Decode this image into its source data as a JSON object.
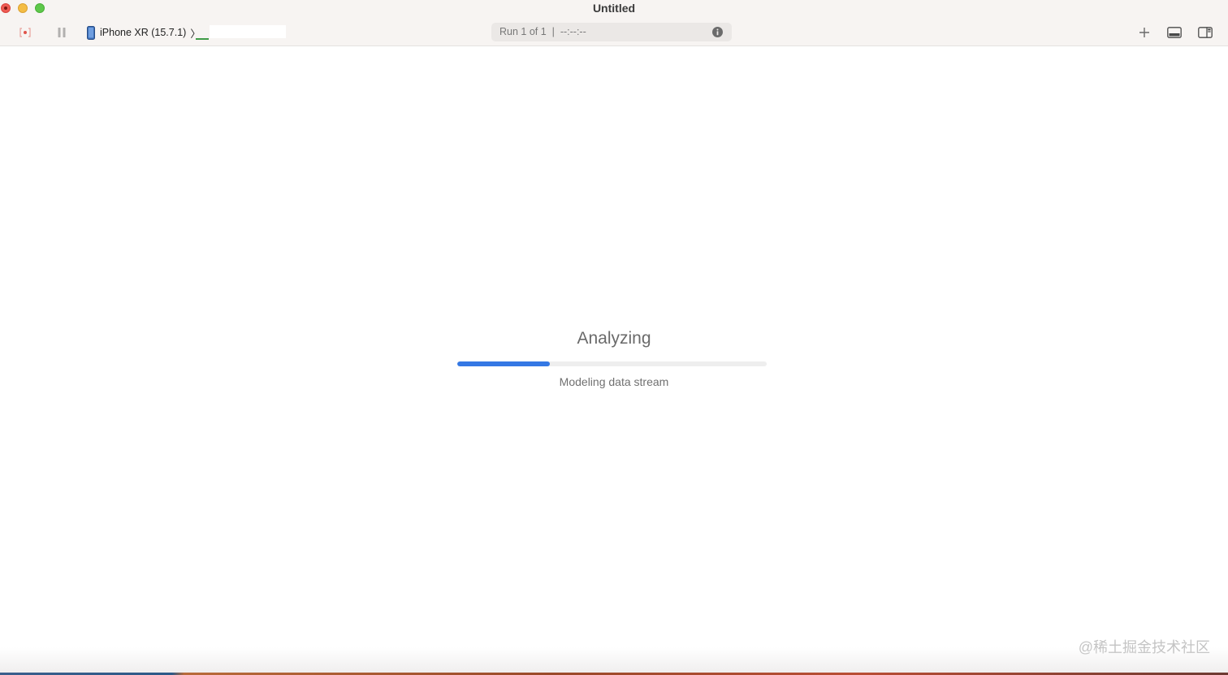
{
  "window": {
    "title": "Untitled"
  },
  "toolbar": {
    "record_icon": "record-icon",
    "pause_icon": "pause-icon",
    "device": {
      "icon": "iphone-icon",
      "label": "iPhone XR (15.7.1)",
      "separator": "〉"
    },
    "status": {
      "text": "Run 1 of 1  |  --:--:--",
      "info_icon": "info-icon"
    },
    "add_icon": "plus-icon",
    "bottom_pane_icon": "bottom-panel-icon",
    "right_pane_icon": "right-panel-icon"
  },
  "main": {
    "title": "Analyzing",
    "progress": 0.3,
    "status": "Modeling data stream"
  },
  "watermark": "@稀土掘金技术社区",
  "colors": {
    "accent": "#3478e4",
    "close": "#ee5b53",
    "minimize": "#f4bd44",
    "maximize": "#5ec84a",
    "record": "#e0534a"
  }
}
